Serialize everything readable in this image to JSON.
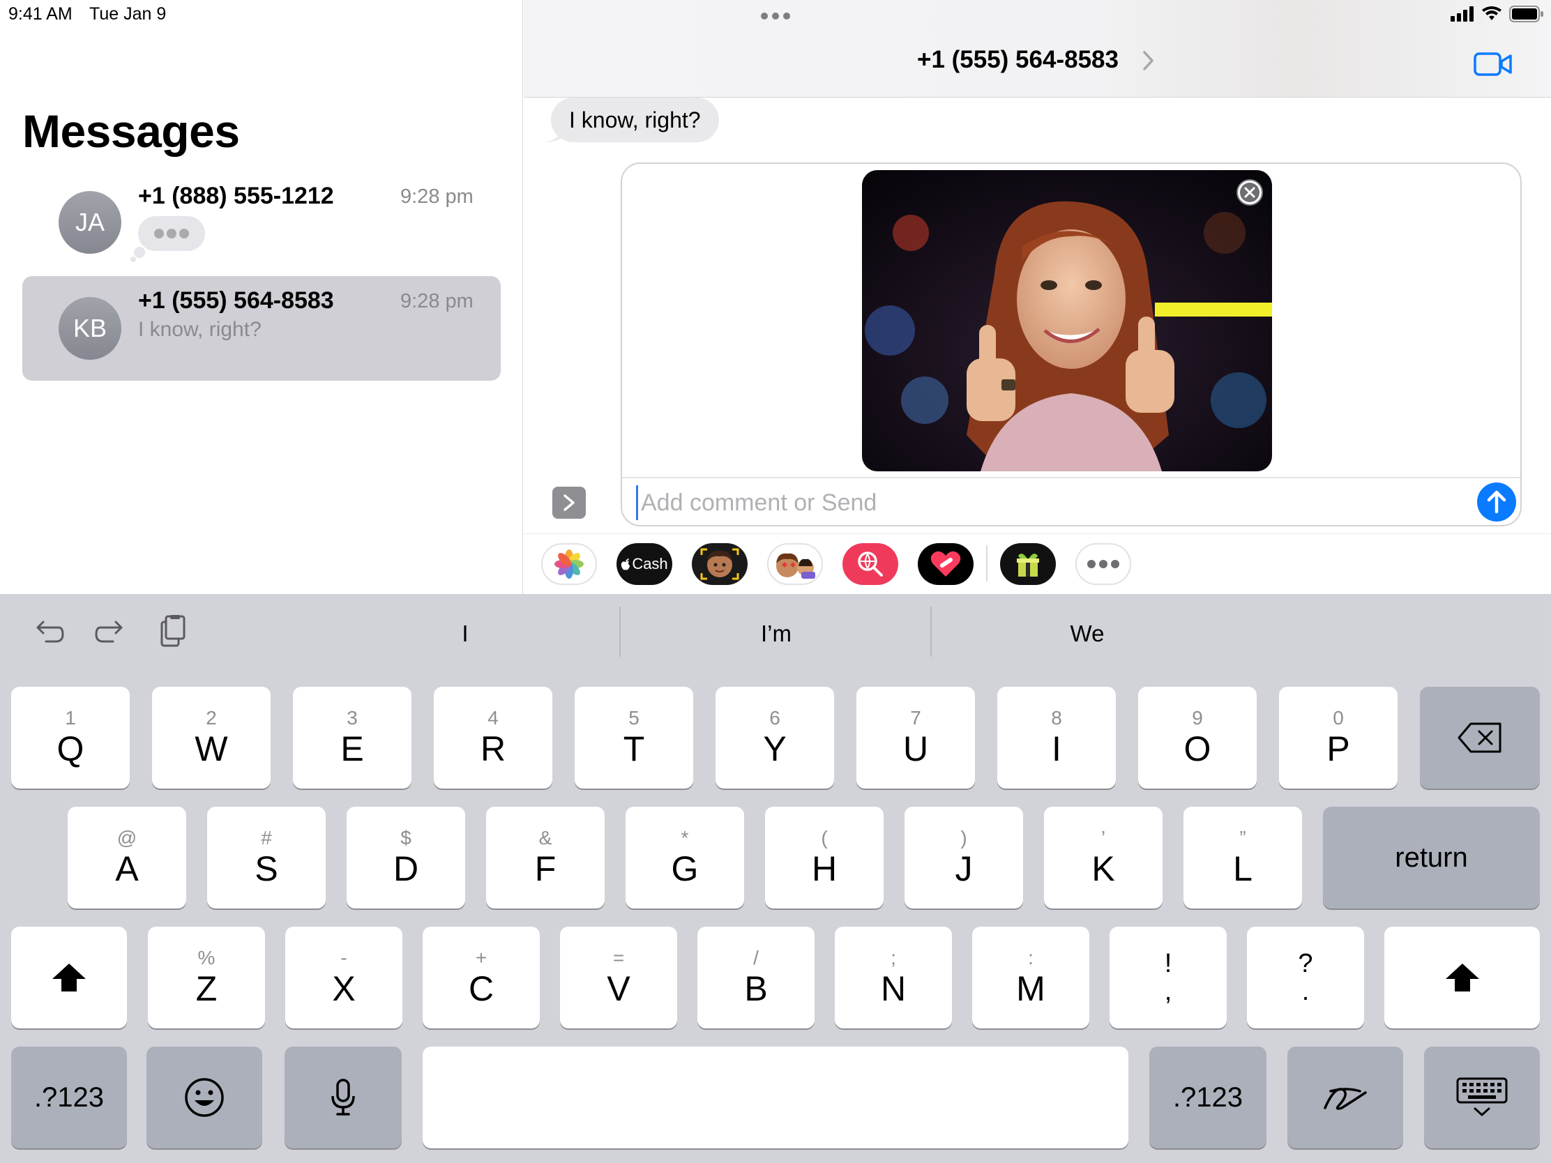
{
  "status_bar": {
    "time": "9:41 AM",
    "date": "Tue Jan 9"
  },
  "sidebar": {
    "title": "Messages",
    "conversations": [
      {
        "initials": "JA",
        "name": "+1 (888) 555-1212",
        "time": "9:28 pm",
        "typing": true
      },
      {
        "initials": "KB",
        "name": "+1 (555) 564-8583",
        "time": "9:28 pm",
        "preview": "I know, right?",
        "selected": true
      }
    ]
  },
  "chat": {
    "title": "+1 (555) 564-8583",
    "incoming_message": "I know, right?",
    "compose_placeholder": "Add comment or Send"
  },
  "app_strip": [
    "photos-icon",
    "apple-cash-icon",
    "memoji-camera-icon",
    "memoji-stickers-icon",
    "image-search-icon",
    "digital-touch-icon",
    "gift-icon",
    "more-apps-icon"
  ],
  "app_strip_labels": {
    "cash": "Cash"
  },
  "keyboard": {
    "suggestions": [
      "I",
      "I’m",
      "We"
    ],
    "row1": [
      {
        "s": "1",
        "p": "Q"
      },
      {
        "s": "2",
        "p": "W"
      },
      {
        "s": "3",
        "p": "E"
      },
      {
        "s": "4",
        "p": "R"
      },
      {
        "s": "5",
        "p": "T"
      },
      {
        "s": "6",
        "p": "Y"
      },
      {
        "s": "7",
        "p": "U"
      },
      {
        "s": "8",
        "p": "I"
      },
      {
        "s": "9",
        "p": "O"
      },
      {
        "s": "0",
        "p": "P"
      }
    ],
    "row2": [
      {
        "s": "@",
        "p": "A"
      },
      {
        "s": "#",
        "p": "S"
      },
      {
        "s": "$",
        "p": "D"
      },
      {
        "s": "&",
        "p": "F"
      },
      {
        "s": "*",
        "p": "G"
      },
      {
        "s": "(",
        "p": "H"
      },
      {
        "s": ")",
        "p": "J"
      },
      {
        "s": "’",
        "p": "K"
      },
      {
        "s": "”",
        "p": "L"
      }
    ],
    "row3": [
      {
        "s": "%",
        "p": "Z"
      },
      {
        "s": "-",
        "p": "X"
      },
      {
        "s": "+",
        "p": "C"
      },
      {
        "s": "=",
        "p": "V"
      },
      {
        "s": "/",
        "p": "B"
      },
      {
        "s": ";",
        "p": "N"
      },
      {
        "s": ":",
        "p": "M"
      },
      {
        "s": "!",
        "p": ","
      },
      {
        "s": "?",
        "p": "."
      }
    ],
    "return_label": "return",
    "numbers_label": ".?123"
  }
}
